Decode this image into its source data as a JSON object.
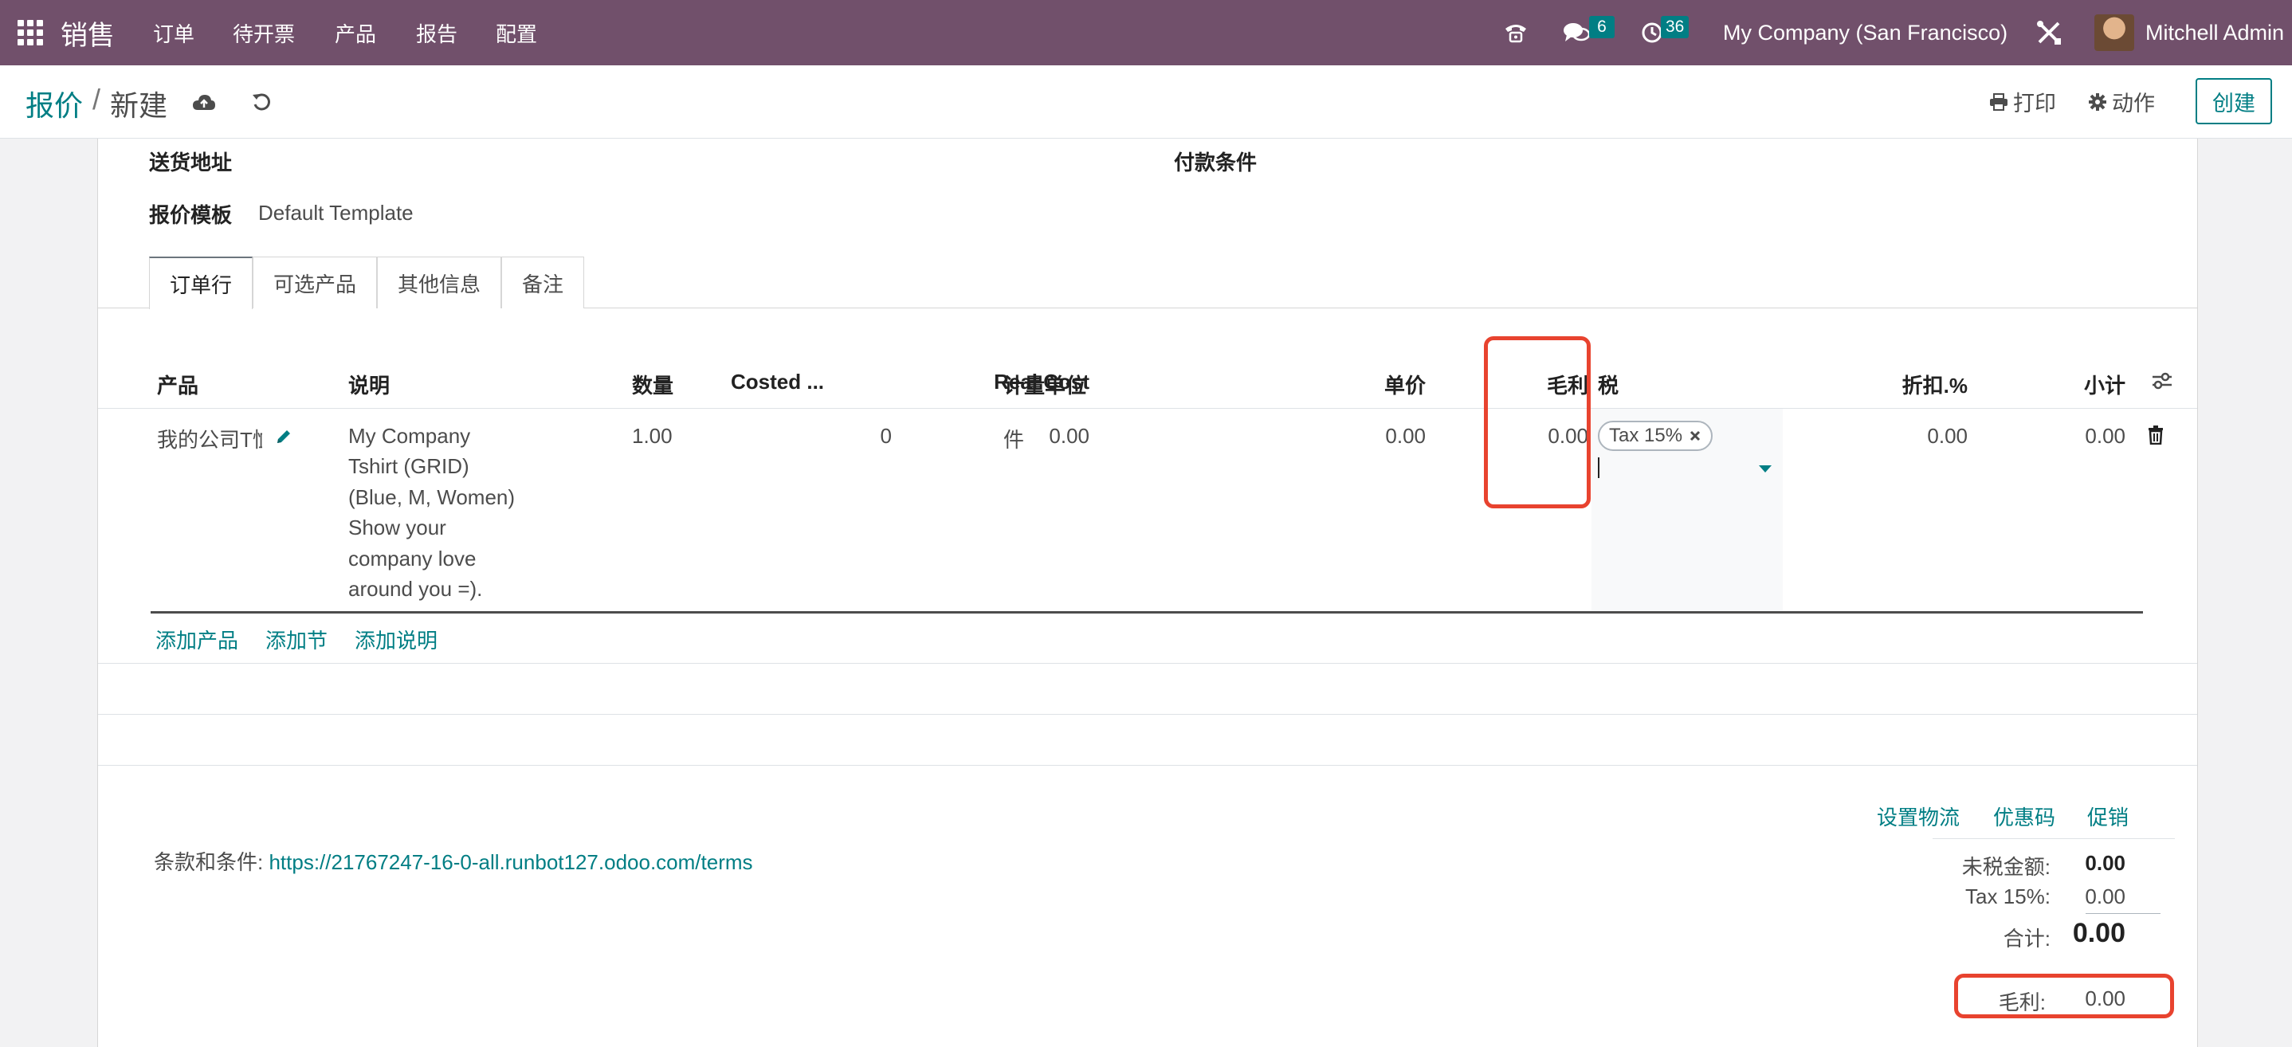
{
  "navbar": {
    "brand": "销售",
    "menu": [
      "订单",
      "待开票",
      "产品",
      "报告",
      "配置"
    ],
    "messages_count": "6",
    "activities_count": "36",
    "company": "My Company (San Francisco)",
    "user": "Mitchell Admin"
  },
  "control_panel": {
    "breadcrumb_parent": "报价",
    "breadcrumb_separator": "/",
    "breadcrumb_current": "新建",
    "print_label": "打印",
    "action_label": "动作",
    "create_label": "创建"
  },
  "form": {
    "delivery_address_label": "送货地址",
    "payment_terms_label": "付款条件",
    "quotation_template_label": "报价模板",
    "quotation_template_value": "Default Template"
  },
  "tabs": [
    "订单行",
    "可选产品",
    "其他信息",
    "备注"
  ],
  "order_lines": {
    "headers": {
      "product": "产品",
      "description": "说明",
      "quantity": "数量",
      "costed": "Costed ...",
      "real_cost": "Real Cost",
      "uom": "计量单位",
      "unit_price": "单价",
      "margin": "毛利",
      "taxes": "税",
      "discount": "折扣.%",
      "subtotal": "小计"
    },
    "rows": [
      {
        "product": "我的公司T恤",
        "description": [
          "My Company",
          "Tshirt (GRID)",
          "(Blue, M, Women)",
          "Show your",
          "company love",
          "around you =)."
        ],
        "quantity": "1.00",
        "costed": "0",
        "real_cost": "0.00",
        "uom": "件",
        "unit_price": "0.00",
        "margin": "0.00",
        "tax_tag": "Tax 15%",
        "discount": "0.00",
        "subtotal": "0.00"
      }
    ],
    "add_product": "添加产品",
    "add_section": "添加节",
    "add_note": "添加说明"
  },
  "footer": {
    "links": [
      "设置物流",
      "优惠码",
      "促销"
    ],
    "terms_label": "条款和条件:",
    "terms_url": "https://21767247-16-0-all.runbot127.odoo.com/terms",
    "untaxed_label": "未税金额:",
    "untaxed_value": "0.00",
    "tax_label": "Tax 15%:",
    "tax_value": "0.00",
    "total_label": "合计:",
    "total_value": "0.00",
    "margin_label": "毛利:",
    "margin_value": "0.00"
  },
  "colors": {
    "navbar": "#71506b",
    "accent": "#017e84",
    "highlight": "#e8432f"
  }
}
